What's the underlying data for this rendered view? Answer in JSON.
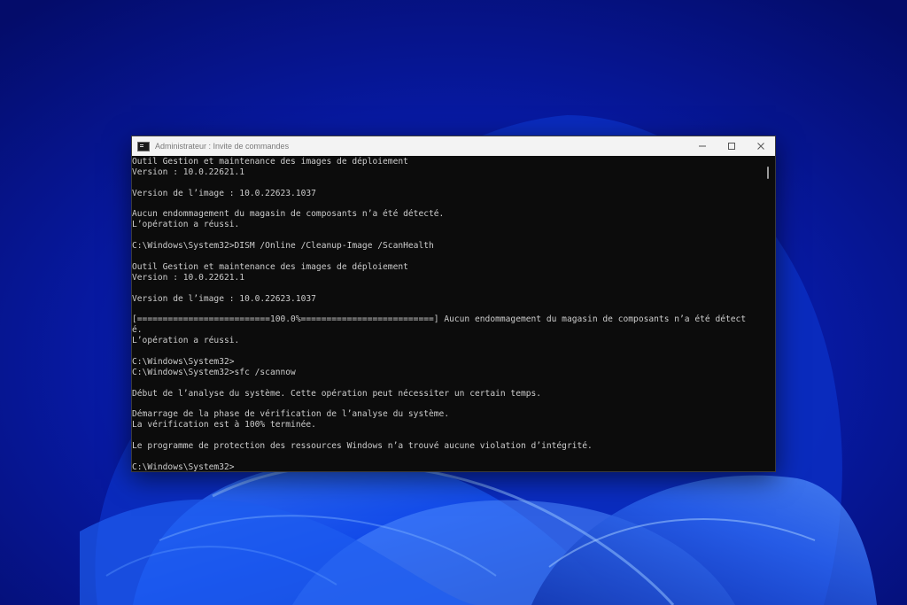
{
  "window": {
    "title": "Administrateur : Invite de commandes",
    "controls": {
      "minimize": "minimize-icon",
      "maximize": "maximize-icon",
      "close": "close-icon"
    }
  },
  "console": {
    "lines": [
      "Outil Gestion et maintenance des images de déploiement",
      "Version : 10.0.22621.1",
      "",
      "Version de l’image : 10.0.22623.1037",
      "",
      "Aucun endommagement du magasin de composants n’a été détecté.",
      "L’opération a réussi.",
      "",
      "C:\\Windows\\System32>DISM /Online /Cleanup-Image /ScanHealth",
      "",
      "Outil Gestion et maintenance des images de déploiement",
      "Version : 10.0.22621.1",
      "",
      "Version de l’image : 10.0.22623.1037",
      "",
      "[==========================100.0%==========================] Aucun endommagement du magasin de composants n’a été détect",
      "é.",
      "L’opération a réussi.",
      "",
      "C:\\Windows\\System32>",
      "C:\\Windows\\System32>sfc /scannow",
      "",
      "Début de l’analyse du système. Cette opération peut nécessiter un certain temps.",
      "",
      "Démarrage de la phase de vérification de l’analyse du système.",
      "La vérification est à 100% terminée.",
      "",
      "Le programme de protection des ressources Windows n’a trouvé aucune violation d’intégrité.",
      "",
      "C:\\Windows\\System32>"
    ]
  },
  "colors": {
    "desktop_background": "#06188f",
    "console_background": "#0c0c0c",
    "console_text": "#cccccc",
    "titlebar": "#f3f3f3"
  }
}
